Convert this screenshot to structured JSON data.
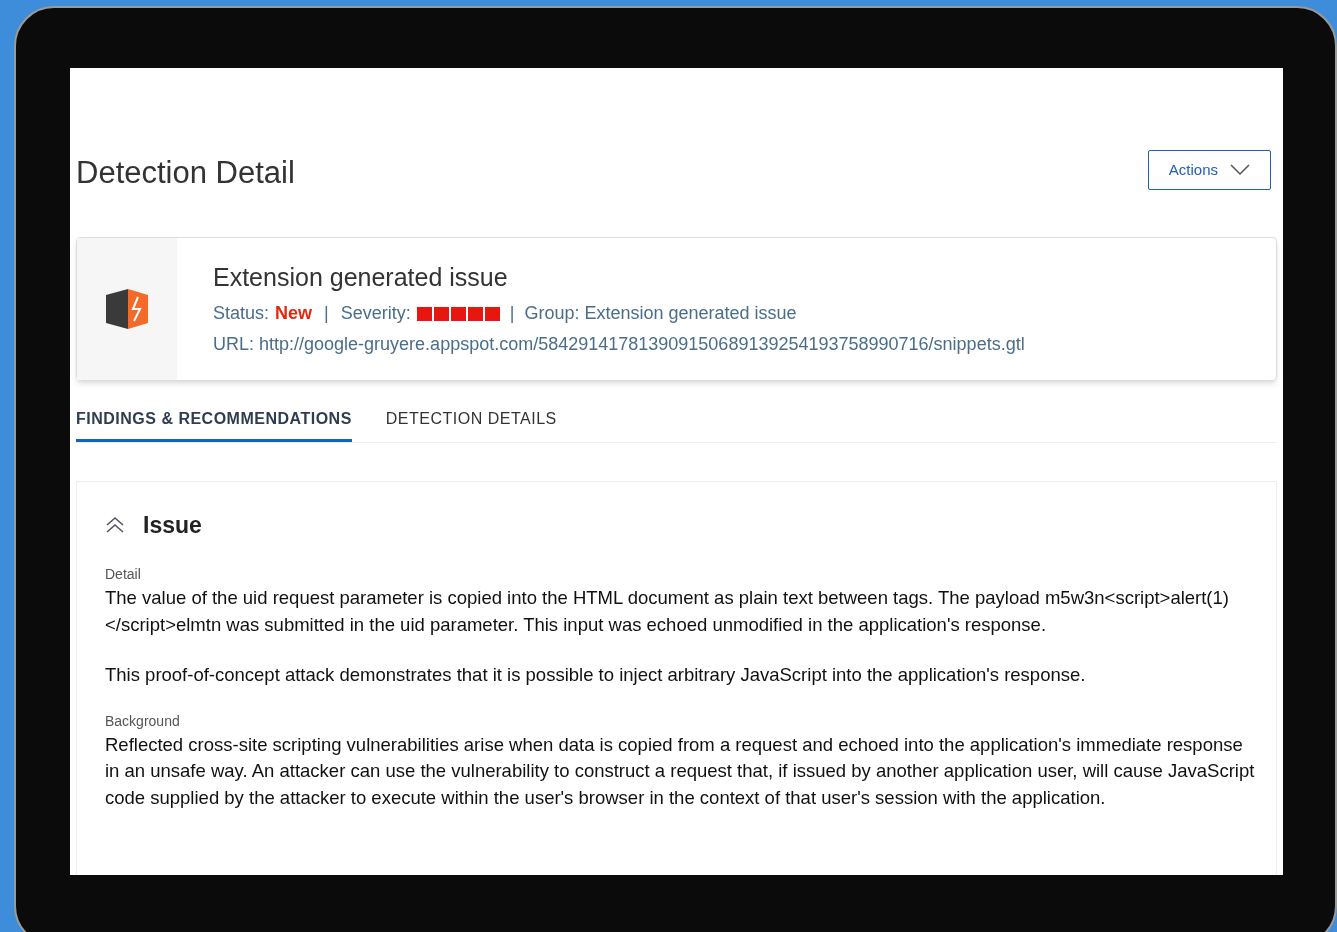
{
  "page": {
    "title": "Detection Detail",
    "actions_button": "Actions"
  },
  "detection": {
    "title": "Extension generated issue",
    "status_label": "Status:",
    "status": "New",
    "severity_label": "Severity:",
    "severity": {
      "stars": 5
    },
    "separator_1": "|",
    "separator_2": "|",
    "group": "Group: Extension generated issue",
    "url": "URL: http://google-gruyere.appspot.com/584291417813909150689139254193758990716/snippets.gtl"
  },
  "tabs": [
    {
      "label": "FINDINGS & RECOMMENDATIONS",
      "selected": true
    },
    {
      "label": "DETECTION DETAILS",
      "selected": false
    }
  ],
  "section": {
    "title": "Issue",
    "expanded": true,
    "fields": [
      {
        "label": "Detail",
        "paragraphs": [
          "The value of the uid request parameter is copied into the HTML document as plain text between tags. The payload m5w3n<script>alert(1)</script>elmtn was submitted in the uid parameter. This input was echoed unmodified in the application's response.",
          "This proof-of-concept attack demonstrates that it is possible to inject arbitrary JavaScript into the application's response."
        ]
      },
      {
        "label": "Background",
        "paragraphs": [
          "Reflected cross-site scripting vulnerabilities arise when data is copied from a request and echoed into the application's immediate response in an unsafe way. An attacker can use the vulnerability to construct a request that, if issued by another application user, will cause JavaScript code supplied by the attacker to execute within the user's browser in the context of that user's session with the application."
        ]
      }
    ]
  }
}
